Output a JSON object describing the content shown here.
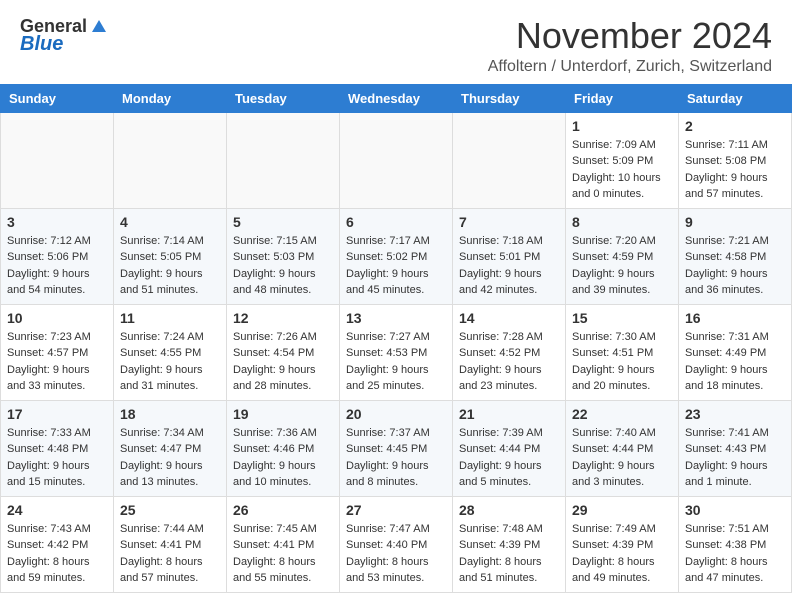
{
  "header": {
    "logo_general": "General",
    "logo_blue": "Blue",
    "month": "November 2024",
    "location": "Affoltern / Unterdorf, Zurich, Switzerland"
  },
  "days_of_week": [
    "Sunday",
    "Monday",
    "Tuesday",
    "Wednesday",
    "Thursday",
    "Friday",
    "Saturday"
  ],
  "weeks": [
    [
      {
        "day": "",
        "info": ""
      },
      {
        "day": "",
        "info": ""
      },
      {
        "day": "",
        "info": ""
      },
      {
        "day": "",
        "info": ""
      },
      {
        "day": "",
        "info": ""
      },
      {
        "day": "1",
        "info": "Sunrise: 7:09 AM\nSunset: 5:09 PM\nDaylight: 10 hours\nand 0 minutes."
      },
      {
        "day": "2",
        "info": "Sunrise: 7:11 AM\nSunset: 5:08 PM\nDaylight: 9 hours\nand 57 minutes."
      }
    ],
    [
      {
        "day": "3",
        "info": "Sunrise: 7:12 AM\nSunset: 5:06 PM\nDaylight: 9 hours\nand 54 minutes."
      },
      {
        "day": "4",
        "info": "Sunrise: 7:14 AM\nSunset: 5:05 PM\nDaylight: 9 hours\nand 51 minutes."
      },
      {
        "day": "5",
        "info": "Sunrise: 7:15 AM\nSunset: 5:03 PM\nDaylight: 9 hours\nand 48 minutes."
      },
      {
        "day": "6",
        "info": "Sunrise: 7:17 AM\nSunset: 5:02 PM\nDaylight: 9 hours\nand 45 minutes."
      },
      {
        "day": "7",
        "info": "Sunrise: 7:18 AM\nSunset: 5:01 PM\nDaylight: 9 hours\nand 42 minutes."
      },
      {
        "day": "8",
        "info": "Sunrise: 7:20 AM\nSunset: 4:59 PM\nDaylight: 9 hours\nand 39 minutes."
      },
      {
        "day": "9",
        "info": "Sunrise: 7:21 AM\nSunset: 4:58 PM\nDaylight: 9 hours\nand 36 minutes."
      }
    ],
    [
      {
        "day": "10",
        "info": "Sunrise: 7:23 AM\nSunset: 4:57 PM\nDaylight: 9 hours\nand 33 minutes."
      },
      {
        "day": "11",
        "info": "Sunrise: 7:24 AM\nSunset: 4:55 PM\nDaylight: 9 hours\nand 31 minutes."
      },
      {
        "day": "12",
        "info": "Sunrise: 7:26 AM\nSunset: 4:54 PM\nDaylight: 9 hours\nand 28 minutes."
      },
      {
        "day": "13",
        "info": "Sunrise: 7:27 AM\nSunset: 4:53 PM\nDaylight: 9 hours\nand 25 minutes."
      },
      {
        "day": "14",
        "info": "Sunrise: 7:28 AM\nSunset: 4:52 PM\nDaylight: 9 hours\nand 23 minutes."
      },
      {
        "day": "15",
        "info": "Sunrise: 7:30 AM\nSunset: 4:51 PM\nDaylight: 9 hours\nand 20 minutes."
      },
      {
        "day": "16",
        "info": "Sunrise: 7:31 AM\nSunset: 4:49 PM\nDaylight: 9 hours\nand 18 minutes."
      }
    ],
    [
      {
        "day": "17",
        "info": "Sunrise: 7:33 AM\nSunset: 4:48 PM\nDaylight: 9 hours\nand 15 minutes."
      },
      {
        "day": "18",
        "info": "Sunrise: 7:34 AM\nSunset: 4:47 PM\nDaylight: 9 hours\nand 13 minutes."
      },
      {
        "day": "19",
        "info": "Sunrise: 7:36 AM\nSunset: 4:46 PM\nDaylight: 9 hours\nand 10 minutes."
      },
      {
        "day": "20",
        "info": "Sunrise: 7:37 AM\nSunset: 4:45 PM\nDaylight: 9 hours\nand 8 minutes."
      },
      {
        "day": "21",
        "info": "Sunrise: 7:39 AM\nSunset: 4:44 PM\nDaylight: 9 hours\nand 5 minutes."
      },
      {
        "day": "22",
        "info": "Sunrise: 7:40 AM\nSunset: 4:44 PM\nDaylight: 9 hours\nand 3 minutes."
      },
      {
        "day": "23",
        "info": "Sunrise: 7:41 AM\nSunset: 4:43 PM\nDaylight: 9 hours\nand 1 minute."
      }
    ],
    [
      {
        "day": "24",
        "info": "Sunrise: 7:43 AM\nSunset: 4:42 PM\nDaylight: 8 hours\nand 59 minutes."
      },
      {
        "day": "25",
        "info": "Sunrise: 7:44 AM\nSunset: 4:41 PM\nDaylight: 8 hours\nand 57 minutes."
      },
      {
        "day": "26",
        "info": "Sunrise: 7:45 AM\nSunset: 4:41 PM\nDaylight: 8 hours\nand 55 minutes."
      },
      {
        "day": "27",
        "info": "Sunrise: 7:47 AM\nSunset: 4:40 PM\nDaylight: 8 hours\nand 53 minutes."
      },
      {
        "day": "28",
        "info": "Sunrise: 7:48 AM\nSunset: 4:39 PM\nDaylight: 8 hours\nand 51 minutes."
      },
      {
        "day": "29",
        "info": "Sunrise: 7:49 AM\nSunset: 4:39 PM\nDaylight: 8 hours\nand 49 minutes."
      },
      {
        "day": "30",
        "info": "Sunrise: 7:51 AM\nSunset: 4:38 PM\nDaylight: 8 hours\nand 47 minutes."
      }
    ]
  ]
}
